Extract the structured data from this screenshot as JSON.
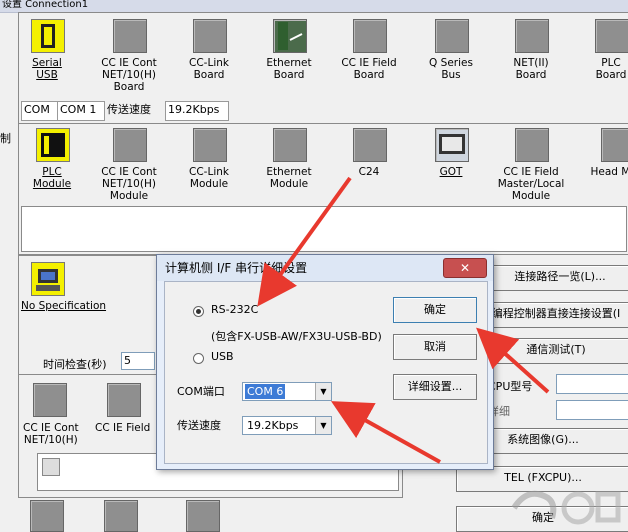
{
  "window": {
    "title": "设置 Connection1"
  },
  "left_labels": {
    "pc_side": "制"
  },
  "pc_if": {
    "items": [
      {
        "label": "Serial\nUSB",
        "icon": "serial-usb-icon"
      },
      {
        "label": "CC IE Cont\nNET/10(H)\nBoard",
        "icon": "board-icon"
      },
      {
        "label": "CC-Link\nBoard",
        "icon": "board-icon"
      },
      {
        "label": "Ethernet\nBoard",
        "icon": "ethernet-board-icon"
      },
      {
        "label": "CC IE Field\nBoard",
        "icon": "board-icon"
      },
      {
        "label": "Q Series\nBus",
        "icon": "board-icon"
      },
      {
        "label": "NET(II)\nBoard",
        "icon": "board-icon"
      },
      {
        "label": "PLC\nBoard",
        "icon": "board-icon"
      }
    ],
    "com_label": "COM",
    "com_value": "COM 1",
    "speed_label": "传送速度",
    "speed_value": "19.2Kbps"
  },
  "plc_if": {
    "items": [
      {
        "label": "PLC\nModule",
        "icon": "plc-module-icon"
      },
      {
        "label": "CC IE Cont\nNET/10(H)\nModule",
        "icon": "module-icon"
      },
      {
        "label": "CC-Link\nModule",
        "icon": "module-icon"
      },
      {
        "label": "Ethernet\nModule",
        "icon": "module-icon"
      },
      {
        "label": "C24",
        "icon": "module-icon"
      },
      {
        "label": "GOT",
        "icon": "got-icon"
      },
      {
        "label": "CC IE Field\nMaster/Local\nModule",
        "icon": "module-icon"
      },
      {
        "label": "Head Mod",
        "icon": "module-icon"
      }
    ]
  },
  "other": {
    "no_spec_label": "No Specification",
    "time_check_label": "时间检查(秒)",
    "time_check_value": "5"
  },
  "network_items": [
    {
      "label": "CC IE Cont\nNET/10(H)"
    },
    {
      "label": "CC IE Field"
    }
  ],
  "right_panel": {
    "route_list": "连接路径一览(L)...",
    "direct_conn": "编程控制器直接连接设置(I",
    "comm_test": "通信测试(T)",
    "cpu_type_label": "CPU型号",
    "detail_label": "详细",
    "system_image": "系统图像(G)...",
    "tel": "TEL (FXCPU)...",
    "ok": "确定"
  },
  "dialog": {
    "title": "计算机侧 I/F 串行详细设置",
    "radio_rs232c": "RS-232C",
    "rs232c_note": "(包含FX-USB-AW/FX3U-USB-BD)",
    "radio_usb": "USB",
    "com_port_label": "COM端口",
    "com_port_value": "COM 6",
    "speed_label": "传送速度",
    "speed_value": "19.2Kbps",
    "ok": "确定",
    "cancel": "取消",
    "detail": "详细设置..."
  },
  "colors": {
    "arrow": "#e8392e",
    "selected": "#3d7bd6",
    "icon_yellow": "#f4f000"
  }
}
